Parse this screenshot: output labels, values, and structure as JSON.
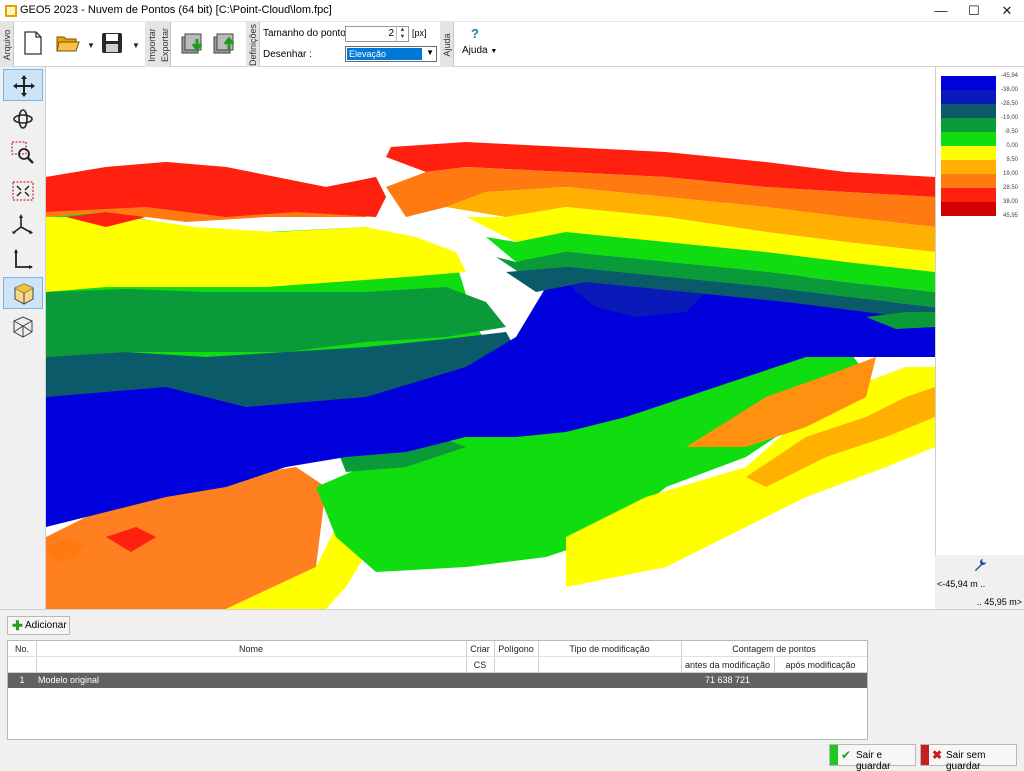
{
  "window": {
    "title": "GEO5 2023 - Nuvem de Pontos (64 bit) [C:\\Point-Cloud\\lom.fpc]",
    "minimize": "—",
    "maximize": "☐",
    "close": "✕"
  },
  "ribbon": {
    "tab_file": "Arquivo",
    "tab_import": "Importar",
    "tab_export": "Exportar",
    "tab_settings": "Definições",
    "tab_help": "Ajuda",
    "point_size_label": "Tamanho do ponto :",
    "point_size_value": "2",
    "point_size_unit": "[px]",
    "draw_label": "Desenhar :",
    "draw_value": "Elevação",
    "help_icon": "?",
    "help_label": "Ajuda"
  },
  "left_tools": [
    "move-tool",
    "rotate-tool",
    "zoom-window-tool",
    "zoom-extents-tool",
    "axes-3d-tool",
    "axes-2d-tool",
    "view-cube-tool",
    "view-cube-tool-2"
  ],
  "legend": {
    "labels": [
      "-45,94",
      "-38,00",
      "-28,50",
      "-19,00",
      "-9,50",
      "0,00",
      "9,50",
      "19,00",
      "28,50",
      "38,00",
      "45,95"
    ],
    "colors": [
      "#0000dd",
      "#0a1ab8",
      "#0a5a6a",
      "#0a9a3a",
      "#10dd10",
      "#ffff00",
      "#ffb000",
      "#ff7a10",
      "#ff2010",
      "#d00000"
    ],
    "range_min": "<-45,94 m ..",
    "range_max": ".. 45,95 m>"
  },
  "bottom": {
    "add_button": "Adicionar",
    "columns": {
      "no": "No.",
      "name": "Nome",
      "create_cs_1": "Criar",
      "create_cs_2": "CS",
      "polygon": "Polígono",
      "modification_type": "Tipo de modificação",
      "point_count": "Contagem de pontos",
      "before": "antes da modificação",
      "after": "após modificação"
    },
    "rows": [
      {
        "no": "1",
        "name": "Modelo original",
        "before": "71 638 721",
        "after": ""
      }
    ],
    "save_exit": "Sair e guardar",
    "exit_no_save": "Sair sem guardar"
  }
}
